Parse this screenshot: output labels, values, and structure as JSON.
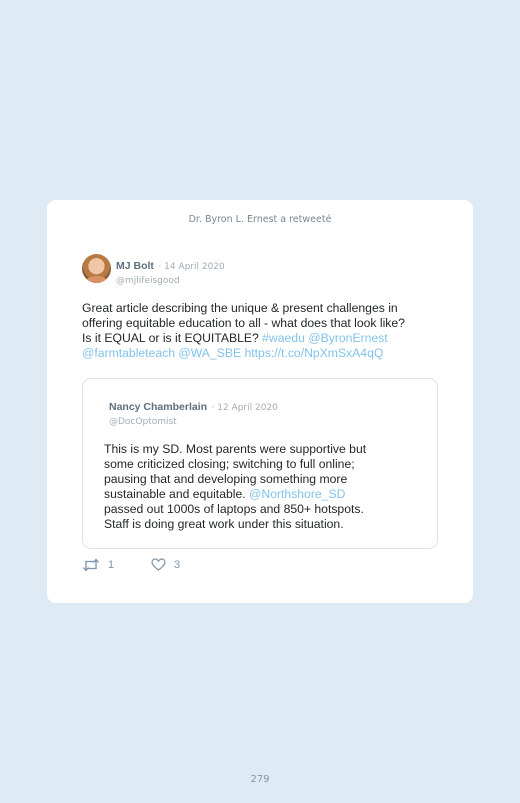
{
  "card": {
    "retweet_note": "Dr. Byron L. Ernest a retweeté",
    "author": {
      "name": "MJ Bolt",
      "date": "· 14 April 2020",
      "handle": "@mjlifeisgood"
    },
    "text_lines": [
      [
        {
          "t": "Great article describing the unique & present challenges in",
          "link": false
        }
      ],
      [
        {
          "t": "offering equitable education to all - what does that look like?",
          "link": false
        }
      ],
      [
        {
          "t": "Is it EQUAL or is it EQUITABLE? ",
          "link": false
        },
        {
          "t": "#waedu @ByronErnest",
          "link": true
        }
      ],
      [
        {
          "t": "@farmtableteach @WA_SBE https://t.co/NpXmSxA4qQ",
          "link": true
        }
      ]
    ],
    "quoted": {
      "name": "Nancy Chamberlain",
      "date": "· 12 April 2020",
      "handle": "@DocOptomist",
      "text_lines": [
        [
          {
            "t": "This is my SD. Most parents were supportive but",
            "link": false
          }
        ],
        [
          {
            "t": "some criticized closing; switching to full online;",
            "link": false
          }
        ],
        [
          {
            "t": "pausing that and developing something more",
            "link": false
          }
        ],
        [
          {
            "t": "sustainable and equitable. ",
            "link": false
          },
          {
            "t": "@Northshore_SD",
            "link": true
          }
        ],
        [
          {
            "t": "passed out 1000s of laptops and 850+ hotspots.",
            "link": false
          }
        ],
        [
          {
            "t": "Staff is doing great work under this situation.",
            "link": false
          }
        ]
      ]
    },
    "actions": {
      "retweet_icon": "retweet-icon",
      "retweet_count": "1",
      "like_icon": "heart-icon",
      "like_count": "3"
    }
  },
  "page_number": "279",
  "colors": {
    "background": "#deebf5",
    "card": "#ffffff",
    "link": "#82c3ea",
    "muted": "#a2adb6",
    "text": "#23272a"
  }
}
